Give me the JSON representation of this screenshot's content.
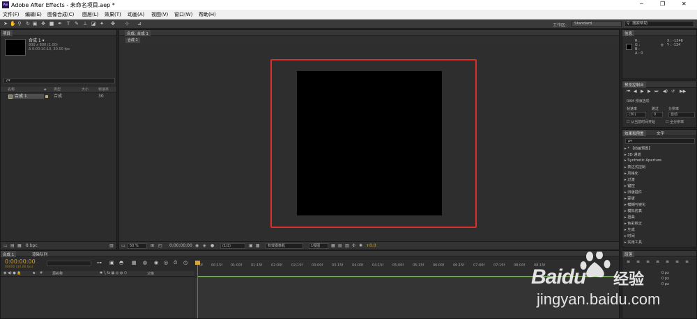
{
  "window": {
    "title": "Adobe After Effects - 未命名项目.aep *",
    "app_badge": "Ae",
    "controls": [
      "─",
      "❐",
      "✕"
    ]
  },
  "menu": [
    "文件(F)",
    "编辑(E)",
    "图像合成(C)",
    "图层(L)",
    "效果(T)",
    "动画(A)",
    "视图(V)",
    "窗口(W)",
    "帮助(H)"
  ],
  "toolbar": {
    "workspace_label": "工作区:",
    "workspace_value": "Standard",
    "search_placeholder": "搜索帮助"
  },
  "project": {
    "tab": "项目",
    "comp_name": "合成 1 ▾",
    "comp_size": "800 x 800 (1.00)",
    "comp_duration": "Δ 0:00:10:10, 30.00 fps",
    "search_glyph": "ρ▾",
    "cols": {
      "name": "名称",
      "type": "类型",
      "size": "大小",
      "fps": "帧速率"
    },
    "row": {
      "name": "合成 1",
      "type": "合成",
      "fps": "30"
    },
    "bpc": "8 bpc"
  },
  "composition": {
    "tab": "合成: 合成 1",
    "subtab": "合成 1",
    "zoom": "50 %",
    "timecode": "0:00:00:00",
    "resolution": "(1/2)",
    "camera": "有效摄像机",
    "view": "1视图",
    "exposure": "+0.0"
  },
  "info": {
    "tab": "信息",
    "r": "R :",
    "g": "G :",
    "b": "B :",
    "a": "A : 0",
    "x": "X : -1346",
    "y": "Y : -134"
  },
  "preview": {
    "tab": "预览控制台",
    "ram": "RAM 预演选项",
    "frame_rate_label": "帧速率",
    "skip_label": "跳过",
    "resolution_label": "分辨率",
    "frame_rate_value": "(30)",
    "skip_value": "0",
    "resolution_value": "自动",
    "from_current": "从当前时间开始",
    "full_screen": "全分辨率"
  },
  "effects": {
    "tabs": [
      "效果和预置",
      "文字"
    ],
    "items": [
      "* 【动画预置】",
      "3D 通道",
      "Synthetic Aperture",
      "表达式控制",
      "风格化",
      "过渡",
      "键控",
      "旧版插件",
      "蒙版",
      "模糊与锐化",
      "模拟仿真",
      "扭曲",
      "色彩校正",
      "生成",
      "时间",
      "实用工具"
    ]
  },
  "timeline": {
    "tabs": [
      "合成 1",
      "渲染队列"
    ],
    "timecode": "0:00:00:00",
    "fps_sub": "00000 (30.00 fps)",
    "source_col": "源名称",
    "parent_col": "父级",
    "ticks": [
      "0f",
      "00:15f",
      "01:00f",
      "01:15f",
      "02:00f",
      "02:15f",
      "03:00f",
      "03:15f",
      "04:00f",
      "04:15f",
      "05:00f",
      "05:15f",
      "06:00f",
      "06:15f",
      "07:00f",
      "07:15f",
      "08:00f",
      "08:15f"
    ]
  },
  "paragraph": {
    "tab": "段落",
    "px1": "0 px",
    "px2": "0 px",
    "px3": "0 px"
  },
  "watermark": {
    "brand": "Baidu",
    "brand_cn": "经验",
    "url": "jingyan.baidu.com"
  },
  "colors": {
    "highlight_box": "#d9302c",
    "panel": "#2c2c2c",
    "timeline_green": "#6ea54a",
    "time_indicator": "#c74a2a"
  }
}
